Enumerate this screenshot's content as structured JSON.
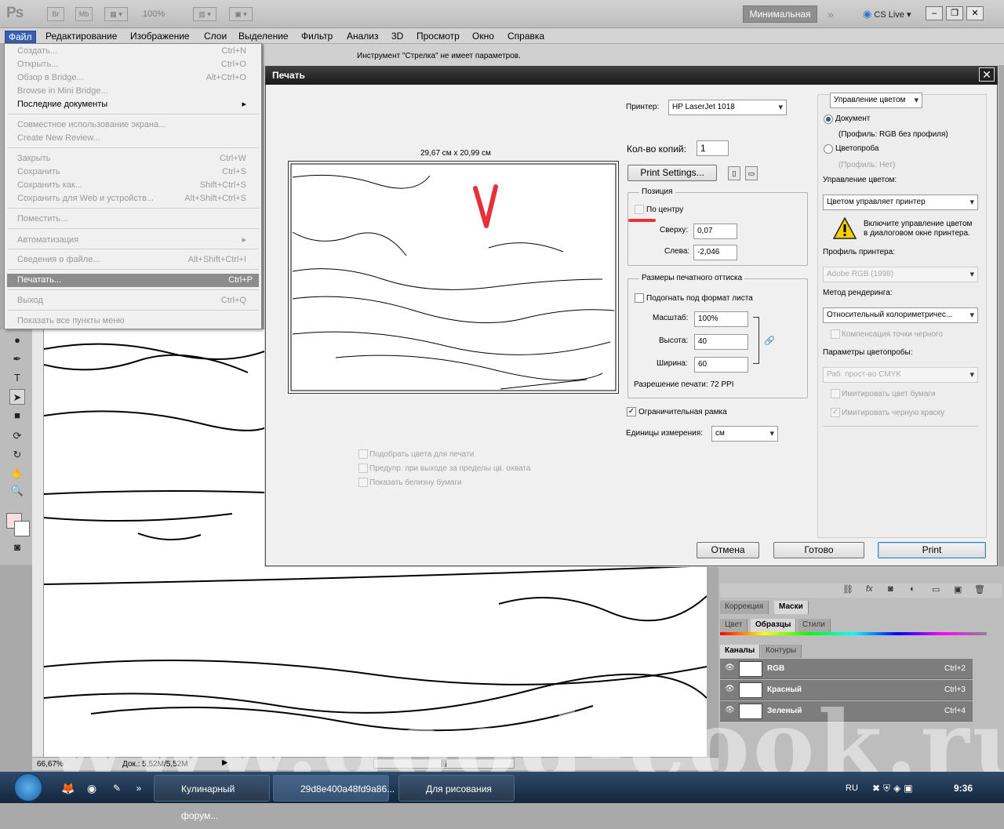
{
  "appbar": {
    "logo": "Ps",
    "br": "Br",
    "mb": "Mb",
    "zoom": "100%",
    "workspace": "Минимальная",
    "cslive": "CS Live"
  },
  "menubar": [
    "Файл",
    "Редактирование",
    "Изображение",
    "Слои",
    "Выделение",
    "Фильтр",
    "Анализ",
    "3D",
    "Просмотр",
    "Окно",
    "Справка"
  ],
  "options_text": "Инструмент \"Стрелка\" не имеет параметров.",
  "file_menu": [
    {
      "label": "Создать...",
      "sc": "Ctrl+N",
      "state": "dis"
    },
    {
      "label": "Открыть...",
      "sc": "Ctrl+O",
      "state": "dis"
    },
    {
      "label": "Обзор в Bridge...",
      "sc": "Alt+Ctrl+O",
      "state": "dis"
    },
    {
      "label": "Browse in Mini Bridge...",
      "sc": "",
      "state": "dis"
    },
    {
      "label": "Последние документы",
      "sc": "▸",
      "state": "on"
    },
    {
      "label": "Совместное использование экрана...",
      "sc": "",
      "state": "dis"
    },
    {
      "label": "Create New Review...",
      "sc": "",
      "state": "dis"
    },
    {
      "label": "Закрыть",
      "sc": "Ctrl+W",
      "state": "dis"
    },
    {
      "label": "Сохранить",
      "sc": "Ctrl+S",
      "state": "dis"
    },
    {
      "label": "Сохранить как...",
      "sc": "Shift+Ctrl+S",
      "state": "dis"
    },
    {
      "label": "Сохранить для Web и устройств...",
      "sc": "Alt+Shift+Ctrl+S",
      "state": "dis"
    },
    {
      "label": "Поместить...",
      "sc": "",
      "state": "dis"
    },
    {
      "label": "Автоматизация",
      "sc": "▸",
      "state": "dis"
    },
    {
      "label": "Сведения о файле...",
      "sc": "Alt+Shift+Ctrl+I",
      "state": "dis"
    },
    {
      "label": "Печатать...",
      "sc": "Ctrl+P",
      "state": "hl"
    },
    {
      "label": "Выход",
      "sc": "Ctrl+Q",
      "state": "dis"
    },
    {
      "label": "Показать все пункты меню",
      "sc": "",
      "state": "dis"
    }
  ],
  "dialog": {
    "title": "Печать",
    "preview_size": "29,67 см x 20,99 см",
    "printer_label": "Принтер:",
    "printer": "HP LaserJet 1018",
    "copies_label": "Кол-во копий:",
    "copies": "1",
    "print_settings": "Print Settings...",
    "position_title": "Позиция",
    "center_label": "По центру",
    "top_label": "Сверху:",
    "top": "0,07",
    "left_label": "Слева:",
    "left": "-2,046",
    "size_title": "Размеры печатного оттиска",
    "fit_label": "Подогнать под формат листа",
    "scale_label": "Масштаб:",
    "scale": "100%",
    "height_label": "Высота:",
    "height": "40",
    "width_label": "Ширина:",
    "width": "60",
    "resolution": "Разрешение печати: 72 PPI",
    "bbox_label": "Ограничительная рамка",
    "units_label": "Единицы измерения:",
    "units": "см",
    "opt1": "Подобрать цвета для печати",
    "opt2": "Предупр. при выходе за пределы цв. охвата",
    "opt3": "Показать белизну бумаги",
    "cm_select": "Управление цветом",
    "doc_radio": "Документ",
    "doc_profile": "(Профиль: RGB без профиля)",
    "proof_radio": "Цветопроба",
    "proof_profile": "(Профиль: Нет)",
    "cm_label": "Управление цветом:",
    "cm_value": "Цветом управляет принтер",
    "warn_text1": "Включите управление цветом",
    "warn_text2": "в диалоговом окне принтера.",
    "printer_profile_label": "Профиль принтера:",
    "printer_profile": "Adobe RGB (1998)",
    "render_label": "Метод рендеринга:",
    "render_value": "Относительный колориметричес...",
    "bpc": "Компенсация точки черного",
    "proof_params_label": "Параметры цветопробы:",
    "proof_params": "Раб. прост-во CMYK",
    "sim_paper": "Имитировать цвет бумаги",
    "sim_ink": "Имитировать черную краску",
    "cancel": "Отмена",
    "done": "Готово",
    "print": "Print"
  },
  "panels": {
    "tabs1": [
      "Коррекция",
      "Маски"
    ],
    "tabs2": [
      "Цвет",
      "Образцы",
      "Стили"
    ],
    "tabs3": [
      "Каналы",
      "Контуры"
    ],
    "channels": [
      {
        "name": "RGB",
        "sc": "Ctrl+2"
      },
      {
        "name": "Красный",
        "sc": "Ctrl+3"
      },
      {
        "name": "Зеленый",
        "sc": "Ctrl+4"
      }
    ]
  },
  "status": {
    "zoom": "66,67%",
    "doc": "Док.: 5,52M/5,52M"
  },
  "taskbar": {
    "t1": "Кулинарный форум...",
    "t2": "29d8e400a48fd9a86...",
    "t3": "Для рисования",
    "lang": "RU",
    "clock": "9:36"
  },
  "watermark": "www.good-cook.ru",
  "annotation": "V"
}
